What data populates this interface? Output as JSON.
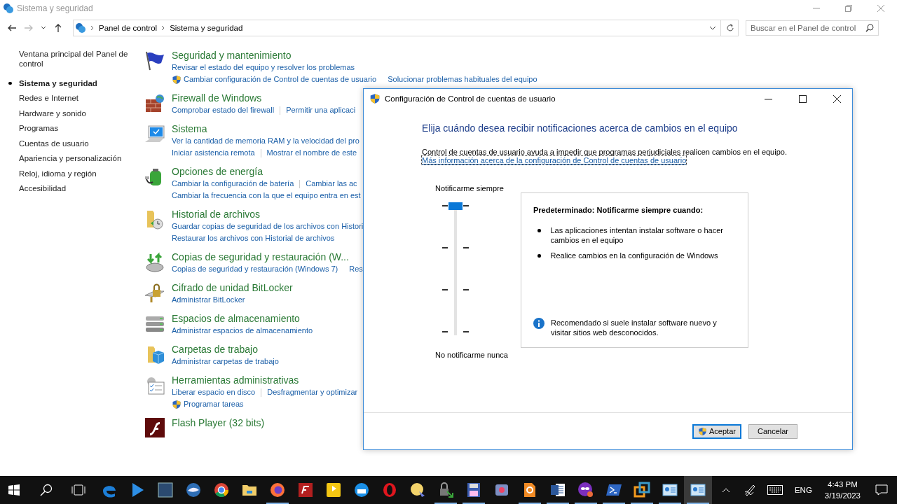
{
  "window": {
    "title": "Sistema y seguridad"
  },
  "address": {
    "path": [
      {
        "label": "Panel de control"
      },
      {
        "label": "Sistema y seguridad"
      }
    ],
    "search_placeholder": "Buscar en el Panel de control"
  },
  "sidebar": {
    "items": [
      {
        "label": "Ventana principal del Panel de control",
        "selected": false
      },
      {
        "label": "Sistema y seguridad",
        "selected": true
      },
      {
        "label": "Redes e Internet",
        "selected": false
      },
      {
        "label": "Hardware y sonido",
        "selected": false
      },
      {
        "label": "Programas",
        "selected": false
      },
      {
        "label": "Cuentas de usuario",
        "selected": false
      },
      {
        "label": "Apariencia y personalización",
        "selected": false
      },
      {
        "label": "Reloj, idioma y región",
        "selected": false
      },
      {
        "label": "Accesibilidad",
        "selected": false
      }
    ]
  },
  "categories": [
    {
      "title": "Seguridad y mantenimiento",
      "lines": [
        [
          {
            "label": "Revisar el estado del equipo y resolver los problemas",
            "shield": false
          }
        ],
        [
          {
            "label": "Cambiar configuración de Control de cuentas de usuario",
            "shield": true
          },
          {
            "label": "Solucionar problemas habituales del equipo",
            "shield": false
          }
        ]
      ]
    },
    {
      "title": "Firewall de Windows",
      "lines": [
        [
          {
            "label": "Comprobar estado del firewall",
            "shield": false
          },
          {
            "label": "Permitir una aplicaci",
            "shield": false
          }
        ]
      ]
    },
    {
      "title": "Sistema",
      "lines": [
        [
          {
            "label": "Ver la cantidad de memoria RAM y la velocidad del pro",
            "shield": false
          }
        ],
        [
          {
            "label": "Iniciar asistencia remota",
            "shield": false
          },
          {
            "label": "Mostrar el nombre de este",
            "shield": false
          }
        ]
      ]
    },
    {
      "title": "Opciones de energía",
      "lines": [
        [
          {
            "label": "Cambiar la configuración de batería",
            "shield": false
          },
          {
            "label": "Cambiar las ac",
            "shield": false
          }
        ],
        [
          {
            "label": "Cambiar la frecuencia con la que el equipo entra en est",
            "shield": false
          }
        ]
      ]
    },
    {
      "title": "Historial de archivos",
      "lines": [
        [
          {
            "label": "Guardar copias de seguridad de los archivos con Histori",
            "shield": false
          }
        ],
        [
          {
            "label": "Restaurar los archivos con Historial de archivos",
            "shield": false
          }
        ]
      ]
    },
    {
      "title": "Copias de seguridad y restauración (W...",
      "lines": [
        [
          {
            "label": "Copias de seguridad y restauración (Windows 7)",
            "shield": false
          },
          {
            "label": "Res",
            "shield": false
          }
        ]
      ]
    },
    {
      "title": "Cifrado de unidad BitLocker",
      "lines": [
        [
          {
            "label": "Administrar BitLocker",
            "shield": false
          }
        ]
      ]
    },
    {
      "title": "Espacios de almacenamiento",
      "lines": [
        [
          {
            "label": "Administrar espacios de almacenamiento",
            "shield": false
          }
        ]
      ]
    },
    {
      "title": "Carpetas de trabajo",
      "lines": [
        [
          {
            "label": "Administrar carpetas de trabajo",
            "shield": false
          }
        ]
      ]
    },
    {
      "title": "Herramientas administrativas",
      "lines": [
        [
          {
            "label": "Liberar espacio en disco",
            "shield": false
          },
          {
            "label": "Desfragmentar y optimizar",
            "shield": false
          }
        ],
        [
          {
            "label": "Programar tareas",
            "shield": true
          }
        ]
      ]
    },
    {
      "title": "Flash Player (32 bits)"
    }
  ],
  "dialog": {
    "title": "Configuración de Control de cuentas de usuario",
    "heading": "Elija cuándo desea recibir notificaciones acerca de cambios en el equipo",
    "description": "Control de cuentas de usuario ayuda a impedir que programas perjudiciales realicen cambios en el equipo.",
    "link": "Más información acerca de la configuración de Control de cuentas de usuario",
    "slider": {
      "top_label": "Notificarme siempre",
      "bottom_label": "No notificarme nunca",
      "level": 1
    },
    "info": {
      "heading": "Predeterminado: Notificarme siempre cuando:",
      "bullets": [
        "Las aplicaciones intentan instalar software o hacer cambios en el equipo",
        "Realice cambios en la configuración de Windows"
      ],
      "note": "Recomendado si suele instalar software nuevo y visitar sitios web desconocidos."
    },
    "buttons": [
      {
        "label": "Aceptar",
        "shield": true,
        "selected": true
      },
      {
        "label": "Cancelar",
        "shield": false,
        "selected": false
      }
    ]
  },
  "taskbar": {
    "apps": [
      {
        "kind": "edge",
        "running": false
      },
      {
        "kind": "play",
        "running": false
      },
      {
        "kind": "hdx",
        "running": false
      },
      {
        "kind": "bird",
        "running": false
      },
      {
        "kind": "chrome",
        "running": false
      },
      {
        "kind": "folder",
        "running": false
      },
      {
        "kind": "firefox",
        "running": true
      },
      {
        "kind": "ftp",
        "running": false
      },
      {
        "kind": "player",
        "running": false
      },
      {
        "kind": "fox",
        "running": false
      },
      {
        "kind": "opera",
        "running": false
      },
      {
        "kind": "paint",
        "running": false
      },
      {
        "kind": "lock",
        "running": true
      },
      {
        "kind": "disk",
        "running": true
      },
      {
        "kind": "photo",
        "running": false
      },
      {
        "kind": "doc",
        "running": true
      },
      {
        "kind": "word",
        "running": true
      },
      {
        "kind": "mask",
        "running": true
      },
      {
        "kind": "shell",
        "running": true
      },
      {
        "kind": "squares",
        "running": true
      },
      {
        "kind": "panel",
        "running": true
      },
      {
        "kind": "panel",
        "running": true,
        "selected": true
      }
    ],
    "language": "ENG",
    "time": "4:43 PM",
    "date": "3/19/2023"
  }
}
